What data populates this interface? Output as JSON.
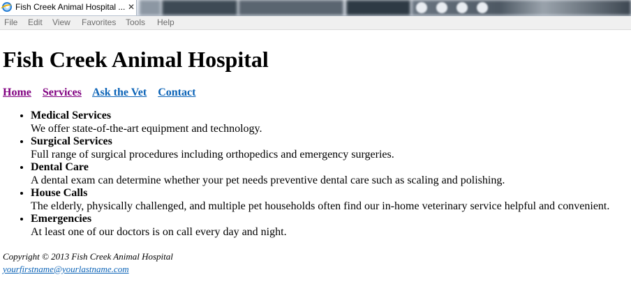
{
  "browser": {
    "tab_title": "Fish Creek Animal Hospital ...",
    "tab_close": "✕",
    "menu": [
      "File",
      "Edit",
      "View",
      "Favorites",
      "Tools",
      "Help"
    ]
  },
  "page": {
    "heading": "Fish Creek Animal Hospital",
    "nav": [
      {
        "label": "Home",
        "state": "visited"
      },
      {
        "label": "Services",
        "state": "visited"
      },
      {
        "label": "Ask the Vet",
        "state": "unvisited"
      },
      {
        "label": "Contact",
        "state": "unvisited"
      }
    ],
    "services": [
      {
        "title": "Medical Services",
        "description": "We offer state-of-the-art equipment and technology."
      },
      {
        "title": "Surgical Services",
        "description": "Full range of surgical procedures including orthopedics and emergency surgeries."
      },
      {
        "title": "Dental Care",
        "description": "A dental exam can determine whether your pet needs preventive dental care such as scaling and polishing."
      },
      {
        "title": "House Calls",
        "description": "The elderly, physically challenged, and multiple pet households often find our in-home veterinary service helpful and convenient."
      },
      {
        "title": "Emergencies",
        "description": "At least one of our doctors is on call every day and night."
      }
    ],
    "footer": {
      "copyright": "Copyright © 2013 Fish Creek Animal Hospital",
      "email": "yourfirstname@yourlastname.com"
    }
  },
  "colors": {
    "visited_link": "#800080",
    "unvisited_link": "#0b63b7",
    "menu_text": "#6d6d6d"
  }
}
